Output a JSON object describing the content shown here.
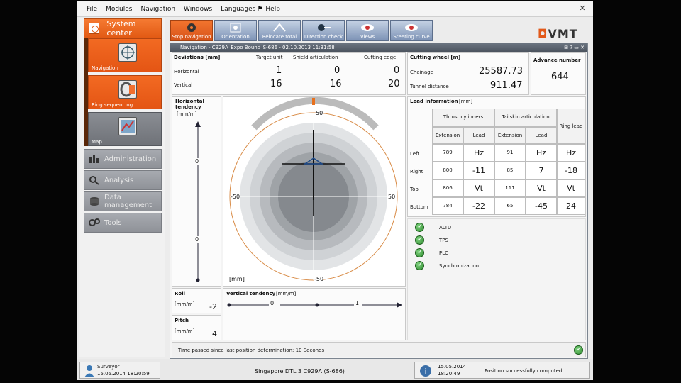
{
  "menu": [
    "File",
    "Modules",
    "Navigation",
    "Windows",
    "Languages",
    "Help"
  ],
  "system_center": {
    "label": "System center"
  },
  "sidebar": {
    "buttons": [
      {
        "label": "Navigation"
      },
      {
        "label": "Ring sequencing"
      },
      {
        "label": "Map"
      }
    ],
    "items": [
      {
        "label": "Administration"
      },
      {
        "label": "Analysis"
      },
      {
        "label": "Data management"
      },
      {
        "label": "Tools"
      }
    ]
  },
  "toolbar": {
    "buttons": [
      {
        "label": "Stop navigation"
      },
      {
        "label": "Orientation"
      },
      {
        "label": "Relocate total"
      },
      {
        "label": "Direction check"
      },
      {
        "label": "Views"
      },
      {
        "label": "Steering curve"
      }
    ]
  },
  "logo": {
    "mark": "◘",
    "text": "VMT"
  },
  "window": {
    "title": "Navigation - C929A_Expo Bound_S-686 - 02.10.2013 11:31:58",
    "controls": "⊞ ? ▭ ✕"
  },
  "deviations": {
    "title": "Deviations [mm]",
    "cols": [
      "Target unit",
      "Shield articulation",
      "Cutting edge"
    ],
    "rows": [
      {
        "label": "Horizontal",
        "values": [
          "1",
          "0",
          "0"
        ]
      },
      {
        "label": "Vertical",
        "values": [
          "16",
          "16",
          "20"
        ]
      }
    ]
  },
  "cutting_wheel": {
    "title": "Cutting wheel [m]",
    "chainage_label": "Chainage",
    "chainage": "25587.73",
    "tunnel_label": "Tunnel distance",
    "tunnel": "911.47"
  },
  "advance": {
    "label": "Advance number",
    "value": "644"
  },
  "htendency": {
    "title": "Horizontal tendency",
    "unit": "[mm/m]",
    "top": "0",
    "bottom": "0"
  },
  "target": {
    "top": "50",
    "bottom": "-50",
    "left": "-50",
    "right": "50",
    "unit": "[mm]"
  },
  "roll": {
    "label": "Roll",
    "unit": "[mm/m]",
    "value": "-2"
  },
  "pitch": {
    "label": "Pitch",
    "unit": "[mm/m]",
    "value": "4"
  },
  "vtendency": {
    "title": "Vertical tendency",
    "unit": "[mm/m]",
    "v1": "0",
    "v2": "1"
  },
  "lead": {
    "title": "Lead information",
    "unit": "[mm]",
    "thrust": "Thrust cylinders",
    "tailskin": "Tailskin articulation",
    "ring": "Ring lead",
    "ext": "Extension",
    "lead": "Lead",
    "rows": [
      {
        "label": "Left",
        "t_ext": "789",
        "t_lead": "Hz",
        "s_ext": "91",
        "s_lead": "Hz",
        "ring": "Hz"
      },
      {
        "label": "Right",
        "t_ext": "800",
        "t_lead": "-11",
        "s_ext": "85",
        "s_lead": "7",
        "ring": "-18"
      },
      {
        "label": "Top",
        "t_ext": "806",
        "t_lead": "Vt",
        "s_ext": "111",
        "s_lead": "Vt",
        "ring": "Vt"
      },
      {
        "label": "Bottom",
        "t_ext": "784",
        "t_lead": "-22",
        "s_ext": "65",
        "s_lead": "-45",
        "ring": "24"
      }
    ]
  },
  "status_checks": [
    "ALTU",
    "TPS",
    "PLC",
    "Synchronization"
  ],
  "time_passed": "Time passed since last position determination: 10 Seconds",
  "user": {
    "role": "Surveyor",
    "datetime": "15.05.2014 18:20:59"
  },
  "project": "Singapore DTL 3 C929A (S-686)",
  "footer_status": {
    "date": "15.05.2014",
    "time": "18:20:49",
    "message": "Position successfully computed"
  }
}
